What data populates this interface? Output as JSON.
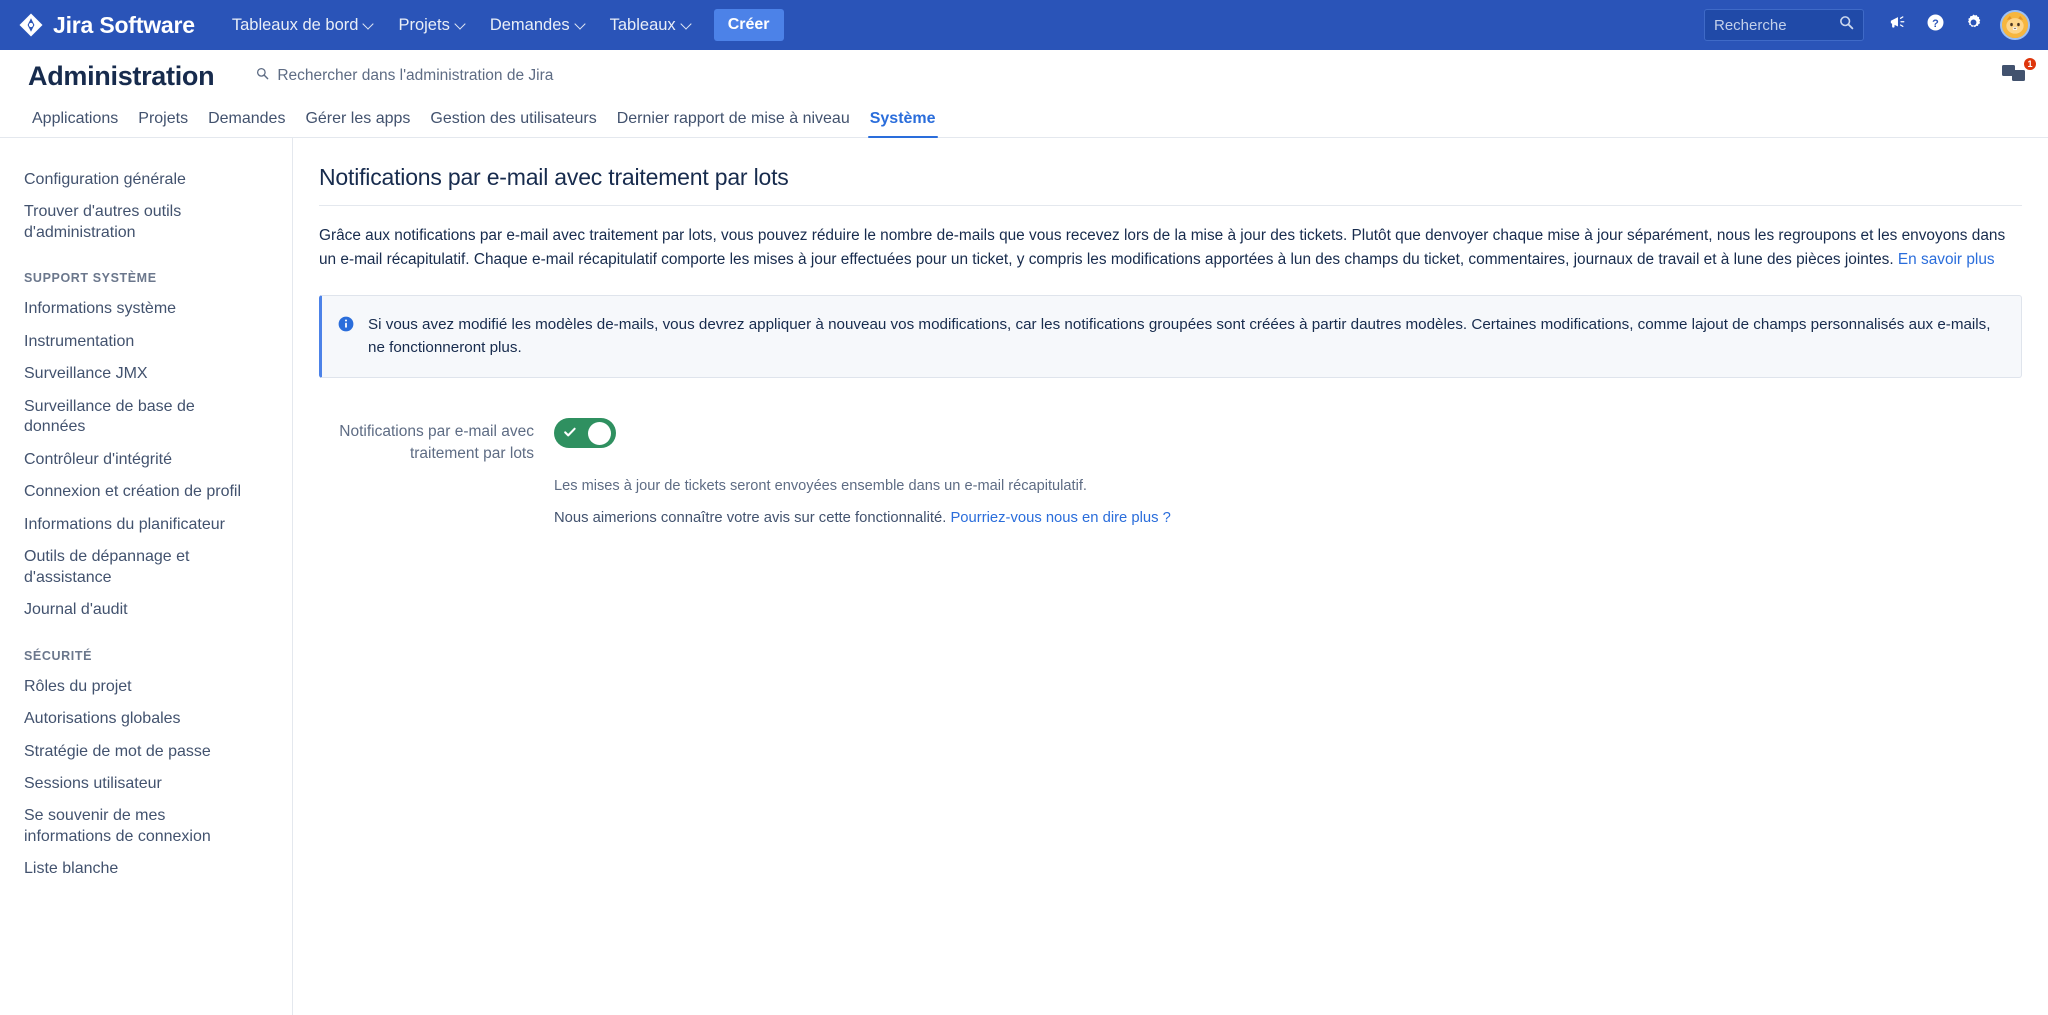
{
  "topnav": {
    "brand": "Jira Software",
    "items": [
      {
        "label": "Tableaux de bord",
        "has_caret": true
      },
      {
        "label": "Projets",
        "has_caret": true
      },
      {
        "label": "Demandes",
        "has_caret": true
      },
      {
        "label": "Tableaux",
        "has_caret": true
      }
    ],
    "create_label": "Créer",
    "search_placeholder": "Recherche",
    "search_value": "",
    "icons": {
      "search": "search-icon",
      "announcements": "megaphone-icon",
      "help": "help-circle-icon",
      "settings": "gear-icon",
      "avatar": "user-avatar"
    },
    "colors": {
      "bar_bg": "#2a54b8",
      "create_bg": "#4c82e8"
    }
  },
  "admin_header": {
    "title": "Administration",
    "search_placeholder": "Rechercher dans l'administration de Jira",
    "feedback_badge": "1"
  },
  "tabs": [
    {
      "label": "Applications",
      "active": false
    },
    {
      "label": "Projets",
      "active": false
    },
    {
      "label": "Demandes",
      "active": false
    },
    {
      "label": "Gérer les apps",
      "active": false
    },
    {
      "label": "Gestion des utilisateurs",
      "active": false
    },
    {
      "label": "Dernier rapport de mise à niveau",
      "active": false
    },
    {
      "label": "Système",
      "active": true
    }
  ],
  "sidebar": {
    "top_items": [
      {
        "label": "Configuration générale"
      },
      {
        "label": "Trouver d'autres outils d'administration"
      }
    ],
    "sections": [
      {
        "heading": "SUPPORT SYSTÈME",
        "items": [
          {
            "label": "Informations système"
          },
          {
            "label": "Instrumentation"
          },
          {
            "label": "Surveillance JMX"
          },
          {
            "label": "Surveillance de base de données"
          },
          {
            "label": "Contrôleur d'intégrité"
          },
          {
            "label": "Connexion et création de profil"
          },
          {
            "label": "Informations du planificateur"
          },
          {
            "label": "Outils de dépannage et d'assistance"
          },
          {
            "label": "Journal d'audit"
          }
        ]
      },
      {
        "heading": "SÉCURITÉ",
        "items": [
          {
            "label": "Rôles du projet"
          },
          {
            "label": "Autorisations globales"
          },
          {
            "label": "Stratégie de mot de passe"
          },
          {
            "label": "Sessions utilisateur"
          },
          {
            "label": "Se souvenir de mes informations de connexion"
          },
          {
            "label": "Liste blanche"
          }
        ]
      }
    ]
  },
  "main": {
    "page_title": "Notifications par e-mail avec traitement par lots",
    "intro_text": "Grâce aux notifications par e-mail avec traitement par lots, vous pouvez réduire le nombre de-mails que vous recevez lors de la mise à jour des tickets. Plutôt que denvoyer chaque mise à jour séparément, nous les regroupons et les envoyons dans un e-mail récapitulatif. Chaque e-mail récapitulatif comporte les mises à jour effectuées pour un ticket, y compris les modifications apportées à lun des champs du ticket, commentaires, journaux de travail et à lune des pièces jointes. ",
    "intro_link": "En savoir plus",
    "info_banner": {
      "icon": "info-circle-icon",
      "text": "Si vous avez modifié les modèles de-mails, vous devrez appliquer à nouveau vos modifications, car les notifications groupées sont créées à partir dautres modèles. Certaines modifications, comme lajout de champs personnalisés aux e-mails, ne fonctionneront plus.",
      "accent_color": "#4c82e8"
    },
    "toggle_field": {
      "label": "Notifications par e-mail avec traitement par lots",
      "state": "on",
      "on_color": "#2f9060",
      "help_text": "Les mises à jour de tickets seront envoyées ensemble dans un e-mail récapitulatif.",
      "feedback_prompt": "Nous aimerions connaître votre avis sur cette fonctionnalité. ",
      "feedback_link": "Pourriez-vous nous en dire plus ?"
    }
  }
}
